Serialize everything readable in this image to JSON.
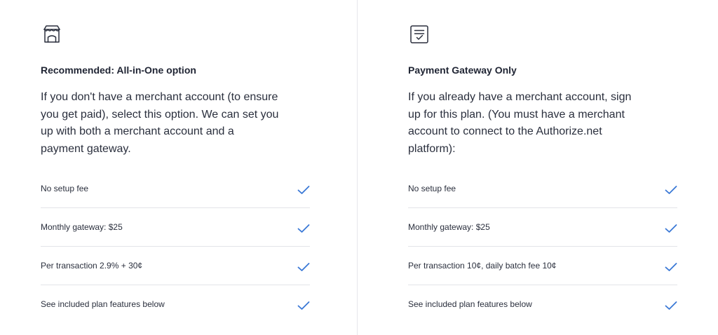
{
  "colors": {
    "check": "#3a78d6",
    "text": "#1f2433",
    "divider": "#e3e4e8"
  },
  "plans": [
    {
      "icon": "storefront-icon",
      "title": "Recommended: All-in-One option",
      "description": "If you don't have a merchant account (to ensure you get paid), select this option. We can set you up with both a merchant account and a payment gateway.",
      "features": [
        {
          "label": "No setup fee",
          "included": true
        },
        {
          "label": "Monthly gateway: $25",
          "included": true
        },
        {
          "label": "Per transaction 2.9% + 30¢",
          "included": true
        },
        {
          "label": "See included plan features below",
          "included": true
        }
      ]
    },
    {
      "icon": "receipt-check-icon",
      "title": "Payment Gateway Only",
      "description": "If you already have a merchant account, sign up for this plan. (You must have a merchant account to connect to the Authorize.net platform):",
      "features": [
        {
          "label": "No setup fee",
          "included": true
        },
        {
          "label": "Monthly gateway: $25",
          "included": true
        },
        {
          "label": "Per transaction 10¢, daily batch fee 10¢",
          "included": true
        },
        {
          "label": "See included plan features below",
          "included": true
        }
      ]
    }
  ]
}
